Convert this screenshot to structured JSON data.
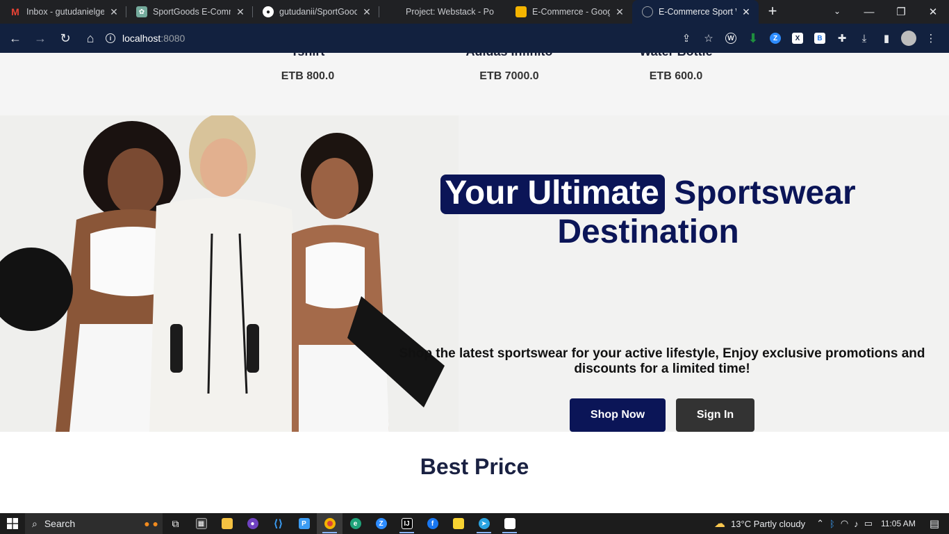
{
  "browser": {
    "tabs": [
      {
        "label": "Inbox - gutudanielgele",
        "icon": "gmail-icon",
        "color": "#ea4335"
      },
      {
        "label": "SportGoods E-Comme",
        "icon": "chatgpt-icon",
        "color": "#74aa9c"
      },
      {
        "label": "gutudanii/SportGoods",
        "icon": "github-icon",
        "color": "#ffffff"
      },
      {
        "label": "Project: Webstack - Po",
        "icon": "blank-icon",
        "color": "#202124"
      },
      {
        "label": "E-Commerce - Google",
        "icon": "google-slides-icon",
        "color": "#f4b400"
      },
      {
        "label": "E-Commerce Sport Wo",
        "icon": "globe-icon",
        "color": "#9aa0a6"
      }
    ],
    "url_host": "localhost",
    "url_port": ":8080"
  },
  "products_strip": {
    "items": [
      {
        "name": "Tshirt",
        "price": "ETB 800.0"
      },
      {
        "name": "Adidas Infinito",
        "price": "ETB 7000.0"
      },
      {
        "name": "Water Bottle",
        "price": "ETB 600.0"
      }
    ]
  },
  "hero": {
    "title_highlight": "Your Ultimate",
    "title_rest": " Sportswear Destination",
    "subtitle": "Shop the latest sportswear for your active lifestyle, Enjoy exclusive promotions and discounts for a limited time!",
    "shop_now": "Shop Now",
    "sign_in": "Sign In",
    "socials": [
      "facebook-icon",
      "instagram-icon",
      "telegram-icon"
    ]
  },
  "best_price": {
    "title": "Best Price"
  },
  "taskbar": {
    "search_label": "Search",
    "weather": "13°C  Partly cloudy",
    "time": "11:05 AM"
  },
  "colors": {
    "brand_navy": "#0b1557",
    "chrome_dark": "#202124",
    "toolbar": "#12213f"
  }
}
